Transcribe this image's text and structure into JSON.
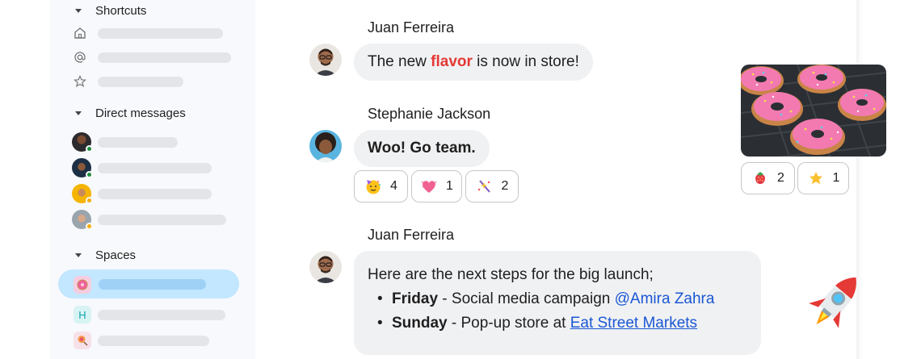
{
  "sidebar": {
    "shortcuts": {
      "label": "Shortcuts",
      "icons": [
        "home-icon",
        "at-sign-icon",
        "star-icon"
      ]
    },
    "direct_messages": {
      "label": "Direct messages"
    },
    "spaces": {
      "label": "Spaces",
      "first_badge": "H"
    }
  },
  "messages": [
    {
      "sender": "Juan Ferreira",
      "text_before": "The new ",
      "text_highlight": "flavor",
      "text_after": " is now in store!"
    },
    {
      "sender": "Stephanie Jackson",
      "text": "Woo! Go team.",
      "reactions": [
        {
          "icon": "party-face-icon",
          "count": "4"
        },
        {
          "icon": "heart-icon",
          "count": "1"
        },
        {
          "icon": "sparkle-icon",
          "count": "2"
        }
      ]
    },
    {
      "sender": "Juan Ferreira",
      "intro": "Here are the next steps for the big launch;",
      "steps": [
        {
          "day": "Friday",
          "text": " - Social media campaign ",
          "mention": "@Amira Zahra"
        },
        {
          "day": "Sunday",
          "text": " - Pop-up store at ",
          "link": "Eat Street Markets"
        }
      ]
    }
  ],
  "image_reactions": [
    {
      "icon": "strawberry-icon",
      "count": "2"
    },
    {
      "icon": "star-icon",
      "count": "1"
    }
  ],
  "colors": {
    "accent": "#1a57d4",
    "highlight": "#e53935",
    "active_space": "#c2e7ff",
    "online": "#1e8e3e",
    "away": "#f9ab00"
  }
}
